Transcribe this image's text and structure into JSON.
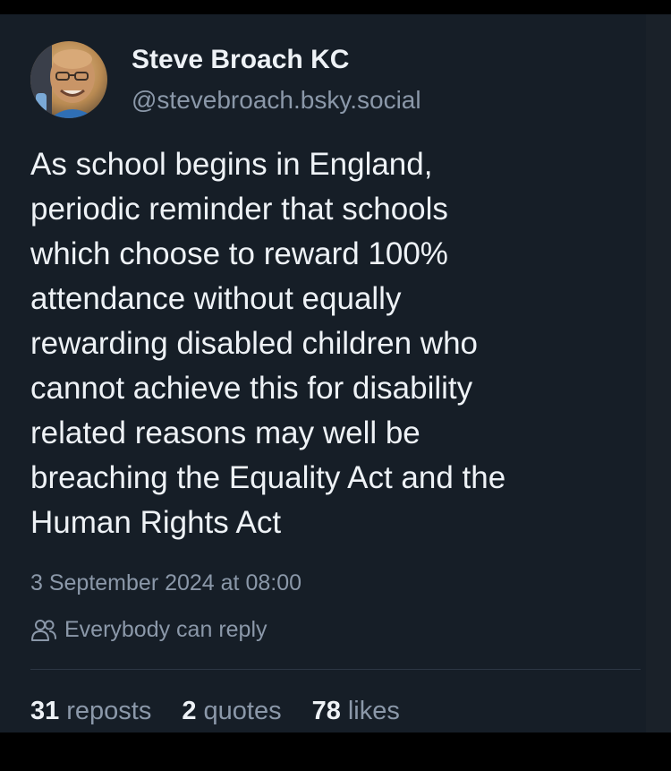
{
  "post": {
    "author": {
      "display_name": "Steve Broach KC",
      "handle": "@stevebroach.bsky.social",
      "avatar_icon": "profile-photo"
    },
    "text_lines": [
      "As school begins in England,",
      "periodic reminder that schools",
      "which choose to reward 100%",
      "attendance without equally",
      "rewarding disabled children who",
      "cannot achieve this for disability",
      "related reasons may well be",
      "breaching the Equality Act and the",
      "Human Rights Act"
    ],
    "timestamp": "3 September 2024 at 08:00",
    "reply_setting": {
      "icon": "people-icon",
      "label": "Everybody can reply"
    },
    "stats": {
      "reposts_count": "31",
      "reposts_label": "reposts",
      "quotes_count": "2",
      "quotes_label": "quotes",
      "likes_count": "78",
      "likes_label": "likes"
    }
  },
  "colors": {
    "card_background": "#161e27",
    "primary_text": "#eef2f6",
    "secondary_text": "#8b98a9",
    "divider": "#2c3643"
  }
}
